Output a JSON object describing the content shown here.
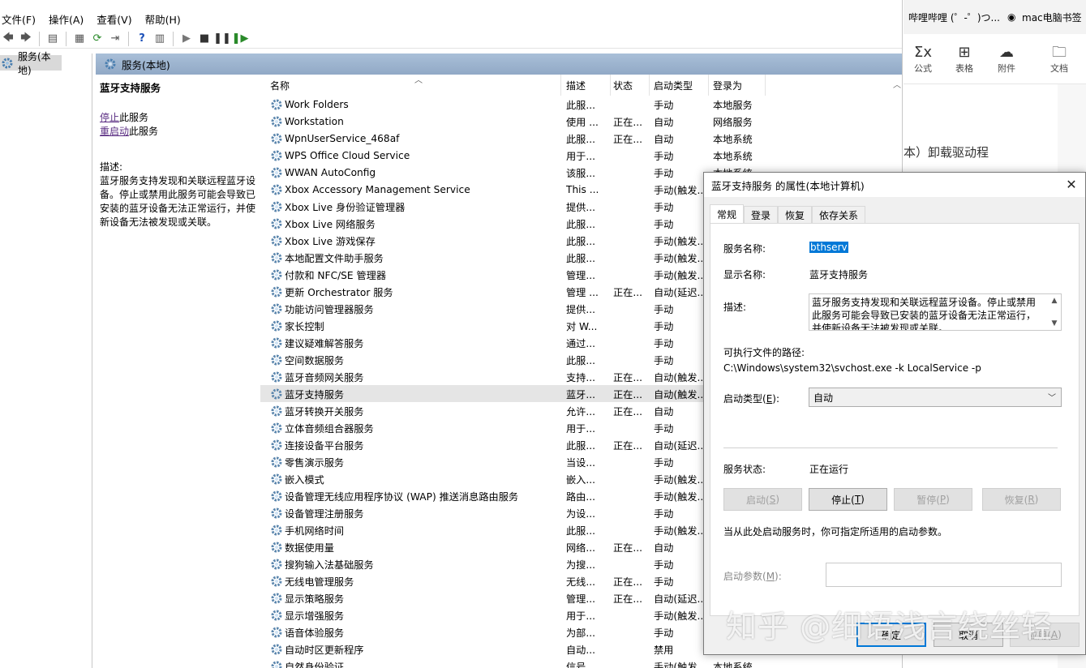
{
  "menubar": {
    "items": [
      "文件(F)",
      "操作(A)",
      "查看(V)",
      "帮助(H)"
    ]
  },
  "tree": {
    "root": "服务(本地)"
  },
  "pane": {
    "header": "服务(本地)"
  },
  "detail": {
    "title": "蓝牙支持服务",
    "stop_link": "停止",
    "stop_suffix": "此服务",
    "restart_link": "重启动",
    "restart_suffix": "此服务",
    "desc_label": "描述:",
    "description": "蓝牙服务支持发现和关联远程蓝牙设备。停止或禁用此服务可能会导致已安装的蓝牙设备无法正常运行，并使新设备无法被发现或关联。"
  },
  "columns": [
    "名称",
    "描述",
    "状态",
    "启动类型",
    "登录为"
  ],
  "services": [
    {
      "name": "Work Folders",
      "desc": "此服...",
      "status": "",
      "start": "手动",
      "logon": "本地服务"
    },
    {
      "name": "Workstation",
      "desc": "使用 ...",
      "status": "正在...",
      "start": "自动",
      "logon": "网络服务"
    },
    {
      "name": "WpnUserService_468af",
      "desc": "此服...",
      "status": "正在...",
      "start": "自动",
      "logon": "本地系统"
    },
    {
      "name": "WPS Office Cloud Service",
      "desc": "用于...",
      "status": "",
      "start": "手动",
      "logon": "本地系统"
    },
    {
      "name": "WWAN AutoConfig",
      "desc": "该服...",
      "status": "",
      "start": "手动",
      "logon": "本地系统"
    },
    {
      "name": "Xbox Accessory Management Service",
      "desc": "This ...",
      "status": "",
      "start": "手动(触发...",
      "logon": ""
    },
    {
      "name": "Xbox Live 身份验证管理器",
      "desc": "提供...",
      "status": "",
      "start": "手动",
      "logon": ""
    },
    {
      "name": "Xbox Live 网络服务",
      "desc": "此服...",
      "status": "",
      "start": "手动",
      "logon": ""
    },
    {
      "name": "Xbox Live 游戏保存",
      "desc": "此服...",
      "status": "",
      "start": "手动(触发...",
      "logon": ""
    },
    {
      "name": "本地配置文件助手服务",
      "desc": "此服...",
      "status": "",
      "start": "手动(触发...",
      "logon": ""
    },
    {
      "name": "付款和 NFC/SE 管理器",
      "desc": "管理...",
      "status": "",
      "start": "手动(触发...",
      "logon": ""
    },
    {
      "name": "更新 Orchestrator 服务",
      "desc": "管理 ...",
      "status": "正在...",
      "start": "自动(延迟...",
      "logon": ""
    },
    {
      "name": "功能访问管理器服务",
      "desc": "提供...",
      "status": "",
      "start": "手动",
      "logon": ""
    },
    {
      "name": "家长控制",
      "desc": "对 W...",
      "status": "",
      "start": "手动",
      "logon": ""
    },
    {
      "name": "建议疑难解答服务",
      "desc": "通过...",
      "status": "",
      "start": "手动",
      "logon": ""
    },
    {
      "name": "空间数据服务",
      "desc": "此服...",
      "status": "",
      "start": "手动",
      "logon": ""
    },
    {
      "name": "蓝牙音频网关服务",
      "desc": "支持...",
      "status": "正在...",
      "start": "自动(触发...",
      "logon": ""
    },
    {
      "name": "蓝牙支持服务",
      "desc": "蓝牙...",
      "status": "正在...",
      "start": "自动(触发...",
      "logon": ""
    },
    {
      "name": "蓝牙转换开关服务",
      "desc": "允许...",
      "status": "正在...",
      "start": "自动",
      "logon": ""
    },
    {
      "name": "立体音频组合器服务",
      "desc": "用于...",
      "status": "",
      "start": "手动",
      "logon": ""
    },
    {
      "name": "连接设备平台服务",
      "desc": "此服...",
      "status": "正在...",
      "start": "自动(延迟...",
      "logon": ""
    },
    {
      "name": "零售演示服务",
      "desc": "当设...",
      "status": "",
      "start": "手动",
      "logon": ""
    },
    {
      "name": "嵌入模式",
      "desc": "嵌入...",
      "status": "",
      "start": "手动(触发...",
      "logon": ""
    },
    {
      "name": "设备管理无线应用程序协议 (WAP) 推送消息路由服务",
      "desc": "路由...",
      "status": "",
      "start": "手动(触发...",
      "logon": ""
    },
    {
      "name": "设备管理注册服务",
      "desc": "为设...",
      "status": "",
      "start": "手动",
      "logon": ""
    },
    {
      "name": "手机网络时间",
      "desc": "此服...",
      "status": "",
      "start": "手动(触发...",
      "logon": ""
    },
    {
      "name": "数据使用量",
      "desc": "网络...",
      "status": "正在...",
      "start": "自动",
      "logon": ""
    },
    {
      "name": "搜狗输入法基础服务",
      "desc": "为搜...",
      "status": "",
      "start": "手动",
      "logon": ""
    },
    {
      "name": "无线电管理服务",
      "desc": "无线...",
      "status": "正在...",
      "start": "手动",
      "logon": ""
    },
    {
      "name": "显示策略服务",
      "desc": "管理...",
      "status": "正在...",
      "start": "自动(延迟...",
      "logon": ""
    },
    {
      "name": "显示增强服务",
      "desc": "用于...",
      "status": "",
      "start": "手动(触发...",
      "logon": ""
    },
    {
      "name": "语音体验服务",
      "desc": "为部...",
      "status": "",
      "start": "手动",
      "logon": ""
    },
    {
      "name": "自动时区更新程序",
      "desc": "自动...",
      "status": "",
      "start": "禁用",
      "logon": ""
    },
    {
      "name": "自然身份验证",
      "desc": "信号...",
      "status": "",
      "start": "手动(触发...",
      "logon": "本地系统"
    }
  ],
  "selected_index": 17,
  "doc_app": {
    "tabs": [
      "哔哩哔哩 (゜-゜)つ...",
      "mac电脑书签"
    ],
    "tools": [
      {
        "icon": "formula-icon",
        "glyph": "Σx",
        "label": "公式"
      },
      {
        "icon": "table-icon",
        "glyph": "⊞",
        "label": "表格"
      },
      {
        "icon": "cloud-icon",
        "glyph": "☁",
        "label": "附件"
      },
      {
        "icon": "folder-plus-icon",
        "glyph": "🗀",
        "label": "文档"
      }
    ],
    "body_text": "本）卸载驱动程"
  },
  "dialog": {
    "title": "蓝牙支持服务 的属性(本地计算机)",
    "tabs": [
      "常规",
      "登录",
      "恢复",
      "依存关系"
    ],
    "service_name_label": "服务名称:",
    "service_name_value": "bthserv",
    "display_name_label": "显示名称:",
    "display_name_value": "蓝牙支持服务",
    "description_label": "描述:",
    "description_value": "蓝牙服务支持发现和关联远程蓝牙设备。停止或禁用此服务可能会导致已安装的蓝牙设备无法正常运行，并使新设备无法被发现或关联。",
    "exe_path_label": "可执行文件的路径:",
    "exe_path_value": "C:\\Windows\\system32\\svchost.exe -k LocalService -p",
    "startup_type_label": "启动类型(",
    "startup_type_label_key": "E",
    "startup_type_label_end": "):",
    "startup_type_value": "自动",
    "service_status_label": "服务状态:",
    "service_status_value": "正在运行",
    "btn_start": "启动(",
    "btn_start_key": "S",
    "btn_stop": "停止(",
    "btn_stop_key": "T",
    "btn_pause": "暂停(",
    "btn_pause_key": "P",
    "btn_resume": "恢复(",
    "btn_resume_key": "R",
    "hint": "当从此处启动服务时，你可指定所适用的启动参数。",
    "param_label": "启动参数(",
    "param_key": "M",
    "param_end": "):",
    "ok": "确定",
    "cancel": "取消",
    "apply": "应用(",
    "apply_key": "A",
    "close_glyph": "✕"
  },
  "watermark": "知乎 @细语浅言绕丝轻"
}
